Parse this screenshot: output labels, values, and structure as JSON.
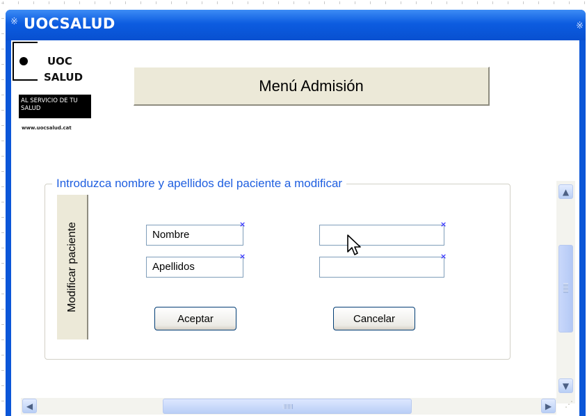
{
  "window": {
    "title": "UOCSALUD",
    "title_glyph": "※"
  },
  "logo": {
    "line1": "UOC",
    "line2": "SALUD",
    "tagline": "AL SERVICIO DE TU SALUD",
    "url": "www.uocsalud.cat"
  },
  "header": {
    "title": "Menú Admisión"
  },
  "group": {
    "legend": "Introduzca nombre y apellidos del paciente a modificar"
  },
  "tab": {
    "label": "Modificar paciente"
  },
  "fields": {
    "nombre_label": "Nombre",
    "apellidos_label": "Apellidos",
    "nombre_value": "",
    "apellidos_value": ""
  },
  "buttons": {
    "accept": "Aceptar",
    "cancel": "Cancelar"
  },
  "scrollbars": {
    "up": "▲",
    "down": "▼",
    "left": "◀",
    "right": "▶"
  },
  "colors": {
    "titlebar": "#0c5ce0",
    "legend_text": "#1f5fe0",
    "panel": "#ece9d8"
  }
}
